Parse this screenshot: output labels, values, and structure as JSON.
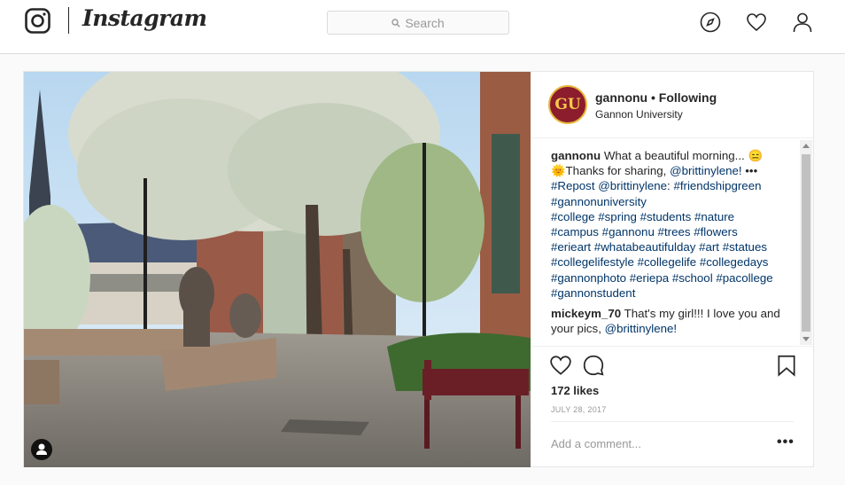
{
  "header": {
    "logo_icon": "instagram-camera-icon",
    "wordmark": "Instagram",
    "search_placeholder": "Search",
    "nav_icons": [
      "compass-icon",
      "heart-icon",
      "person-icon"
    ]
  },
  "post": {
    "avatar_text": "GU",
    "username": "gannonu",
    "separator": " • ",
    "follow_status": "Following",
    "location": "Gannon University",
    "caption": {
      "user": "gannonu",
      "text_1": "What a beautiful morning... 😑",
      "text_2": "🌞Thanks for sharing, ",
      "mention_1": "@brittinylene!",
      "ellipsis": " •••",
      "repost": "#Repost",
      "mention_2": "@brittinylene",
      "colon": ": ",
      "hashtags": [
        "#friendshipgreen",
        "#gannonuniversity",
        "#college",
        "#spring",
        "#students",
        "#nature",
        "#campus",
        "#gannonu",
        "#trees",
        "#flowers",
        "#erieart",
        "#whatabeautifulday",
        "#art",
        "#statues",
        "#collegelifestyle",
        "#collegelife",
        "#collegedays",
        "#gannonphoto",
        "#eriepa",
        "#school",
        "#pacollege",
        "#gannonstudent"
      ]
    },
    "comments": [
      {
        "user": "mickeym_70",
        "text": "That's my girl!!! I love you and your pics, ",
        "mention": "@brittinylene!"
      }
    ],
    "likes": "172 likes",
    "date": "JULY 28, 2017",
    "add_comment_placeholder": "Add a comment...",
    "more_label": "•••"
  },
  "colors": {
    "accent_link": "#003569",
    "avatar_bg": "#8b1d2c",
    "avatar_ring": "#e6b93c",
    "muted": "#999999"
  }
}
